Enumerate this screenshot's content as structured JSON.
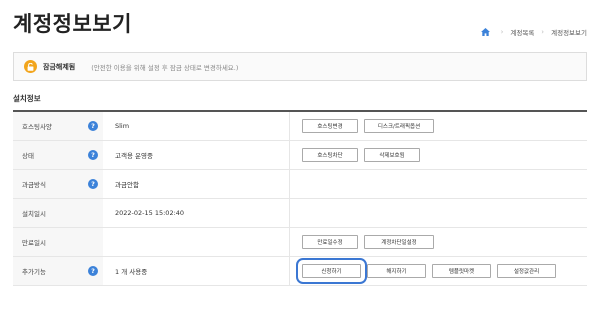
{
  "page": {
    "title": "계정정보보기"
  },
  "breadcrumb": {
    "items": [
      "계정목록",
      "계정정보보기"
    ]
  },
  "lock_notice": {
    "title": "잠금해제됨",
    "description": "(안전한 이용을 위해 설정 후 잠금 상태로 변경하세요.)"
  },
  "section": {
    "title": "설치정보"
  },
  "table": {
    "rows": [
      {
        "label": "호스팅사양",
        "value": "Slim",
        "help": true,
        "buttons": [
          "호스팅변경",
          "디스크/트래픽옵션"
        ]
      },
      {
        "label": "상태",
        "value": "고객용 운영중",
        "help": true,
        "buttons": [
          "호스팅차단",
          "삭제보호됨"
        ]
      },
      {
        "label": "과금방식",
        "value": "과금안함",
        "help": true,
        "buttons": []
      },
      {
        "label": "설치일시",
        "value": "2022-02-15 15:02:40",
        "help": false,
        "buttons": []
      },
      {
        "label": "만료일시",
        "value": "",
        "help": false,
        "buttons": [
          "만료일수정",
          "계정차단일설정"
        ]
      },
      {
        "label": "추가기능",
        "value": "1 개 사용중",
        "help": true,
        "buttons": [
          "신청하기",
          "해지하기",
          "템플릿마켓",
          "설정값관리"
        ]
      }
    ]
  },
  "icons": {
    "help_glyph": "?"
  },
  "colors": {
    "accent_blue": "#3c82d9",
    "lock_orange": "#f2a51c",
    "highlight_outline": "#3b77d3"
  }
}
